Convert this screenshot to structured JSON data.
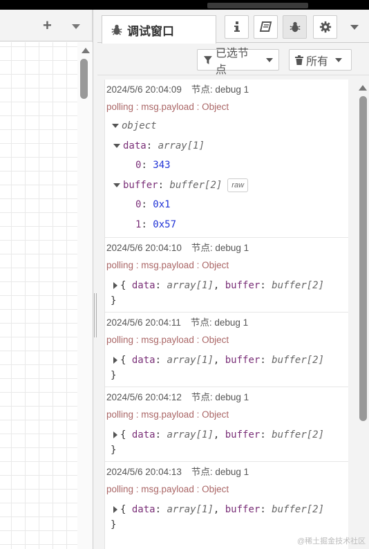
{
  "workspace": {
    "add_label": "+"
  },
  "debug": {
    "tab_label": "调试窗口",
    "filter_nodes_label": "已选节点",
    "clear_label": "所有",
    "messages": [
      {
        "time": "2024/5/6 20:04:09",
        "node": "节点: debug 1",
        "topic": "polling : msg.payload : Object",
        "expanded": true,
        "root_type": "object",
        "data_key": "data",
        "data_type": "array[1]",
        "data_items": [
          {
            "index": "0",
            "value": "343"
          }
        ],
        "buffer_key": "buffer",
        "buffer_type": "buffer[2]",
        "raw_label": "raw",
        "buffer_items": [
          {
            "index": "0",
            "value": "0x1"
          },
          {
            "index": "1",
            "value": "0x57"
          }
        ]
      },
      {
        "time": "2024/5/6 20:04:10",
        "node": "节点: debug 1",
        "topic": "polling : msg.payload : Object",
        "summary_data_type": "array[1]",
        "summary_buffer_type": "buffer[2]"
      },
      {
        "time": "2024/5/6 20:04:11",
        "node": "节点: debug 1",
        "topic": "polling : msg.payload : Object",
        "summary_data_type": "array[1]",
        "summary_buffer_type": "buffer[2]"
      },
      {
        "time": "2024/5/6 20:04:12",
        "node": "节点: debug 1",
        "topic": "polling : msg.payload : Object",
        "summary_data_type": "array[1]",
        "summary_buffer_type": "buffer[2]"
      },
      {
        "time": "2024/5/6 20:04:13",
        "node": "节点: debug 1",
        "topic": "polling : msg.payload : Object",
        "summary_data_type": "array[1]",
        "summary_buffer_type": "buffer[2]"
      }
    ]
  },
  "watermark": "@稀土掘金技术社区",
  "icons": [
    "plus-icon",
    "bug-icon",
    "info-icon",
    "book-icon",
    "gear-icon",
    "filter-icon",
    "trash-icon",
    "caret-down-icon",
    "scroll-up-icon"
  ]
}
